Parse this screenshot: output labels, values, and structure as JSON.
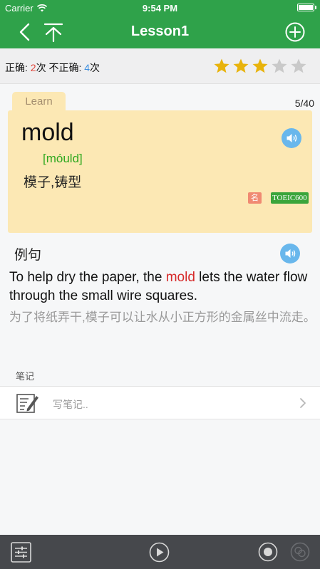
{
  "status_bar": {
    "carrier": "Carrier",
    "time": "9:54 PM"
  },
  "nav": {
    "title": "Lesson1"
  },
  "score": {
    "correct_label": "正确:",
    "correct_count": "2",
    "times_unit": "次",
    "incorrect_label": "不正确:",
    "incorrect_count": "4",
    "rating": 3,
    "max_rating": 5
  },
  "card": {
    "tab_label": "Learn",
    "counter": "5/40",
    "word": "mold",
    "phonetic": "[móuld]",
    "meaning": "模子,铸型",
    "pos_badge": "名",
    "level_badge": "TOEIC600"
  },
  "example": {
    "title": "例句",
    "sentence_before": "To help dry the paper, the ",
    "sentence_highlight": "mold",
    "sentence_after": " lets the water flow through the small wire squares.",
    "translation": "为了将纸弄干,模子可以让水从小正方形的金属丝中流走。"
  },
  "notes": {
    "label": "笔记",
    "placeholder": "写笔记.."
  },
  "colors": {
    "brand_green": "#2fa24a",
    "card_bg": "#fce8b4",
    "star_filled": "#e8b30c",
    "star_empty": "#c9c9c9",
    "highlight_red": "#d62a2a",
    "phonetic_green": "#2fa81f",
    "speaker_blue": "#69b7ec",
    "toolbar_bg": "#46484c"
  },
  "icons": {
    "back": "chevron-left-icon",
    "download": "arrow-down-icon",
    "add": "plus-circle-icon",
    "speaker": "speaker-icon",
    "notes": "notepad-pencil-icon",
    "settings": "sliders-icon",
    "play": "play-circle-icon",
    "record": "record-icon",
    "compare": "compare-audio-icon"
  }
}
